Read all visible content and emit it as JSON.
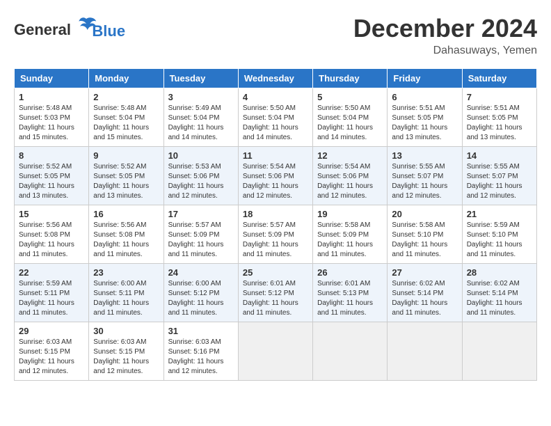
{
  "header": {
    "logo_line1": "General",
    "logo_line2": "Blue",
    "month": "December 2024",
    "location": "Dahasuways, Yemen"
  },
  "weekdays": [
    "Sunday",
    "Monday",
    "Tuesday",
    "Wednesday",
    "Thursday",
    "Friday",
    "Saturday"
  ],
  "weeks": [
    [
      {
        "day": "1",
        "sunrise": "5:48 AM",
        "sunset": "5:03 PM",
        "daylight": "11 hours and 15 minutes."
      },
      {
        "day": "2",
        "sunrise": "5:48 AM",
        "sunset": "5:04 PM",
        "daylight": "11 hours and 15 minutes."
      },
      {
        "day": "3",
        "sunrise": "5:49 AM",
        "sunset": "5:04 PM",
        "daylight": "11 hours and 14 minutes."
      },
      {
        "day": "4",
        "sunrise": "5:50 AM",
        "sunset": "5:04 PM",
        "daylight": "11 hours and 14 minutes."
      },
      {
        "day": "5",
        "sunrise": "5:50 AM",
        "sunset": "5:04 PM",
        "daylight": "11 hours and 14 minutes."
      },
      {
        "day": "6",
        "sunrise": "5:51 AM",
        "sunset": "5:05 PM",
        "daylight": "11 hours and 13 minutes."
      },
      {
        "day": "7",
        "sunrise": "5:51 AM",
        "sunset": "5:05 PM",
        "daylight": "11 hours and 13 minutes."
      }
    ],
    [
      {
        "day": "8",
        "sunrise": "5:52 AM",
        "sunset": "5:05 PM",
        "daylight": "11 hours and 13 minutes."
      },
      {
        "day": "9",
        "sunrise": "5:52 AM",
        "sunset": "5:05 PM",
        "daylight": "11 hours and 13 minutes."
      },
      {
        "day": "10",
        "sunrise": "5:53 AM",
        "sunset": "5:06 PM",
        "daylight": "11 hours and 12 minutes."
      },
      {
        "day": "11",
        "sunrise": "5:54 AM",
        "sunset": "5:06 PM",
        "daylight": "11 hours and 12 minutes."
      },
      {
        "day": "12",
        "sunrise": "5:54 AM",
        "sunset": "5:06 PM",
        "daylight": "11 hours and 12 minutes."
      },
      {
        "day": "13",
        "sunrise": "5:55 AM",
        "sunset": "5:07 PM",
        "daylight": "11 hours and 12 minutes."
      },
      {
        "day": "14",
        "sunrise": "5:55 AM",
        "sunset": "5:07 PM",
        "daylight": "11 hours and 12 minutes."
      }
    ],
    [
      {
        "day": "15",
        "sunrise": "5:56 AM",
        "sunset": "5:08 PM",
        "daylight": "11 hours and 11 minutes."
      },
      {
        "day": "16",
        "sunrise": "5:56 AM",
        "sunset": "5:08 PM",
        "daylight": "11 hours and 11 minutes."
      },
      {
        "day": "17",
        "sunrise": "5:57 AM",
        "sunset": "5:09 PM",
        "daylight": "11 hours and 11 minutes."
      },
      {
        "day": "18",
        "sunrise": "5:57 AM",
        "sunset": "5:09 PM",
        "daylight": "11 hours and 11 minutes."
      },
      {
        "day": "19",
        "sunrise": "5:58 AM",
        "sunset": "5:09 PM",
        "daylight": "11 hours and 11 minutes."
      },
      {
        "day": "20",
        "sunrise": "5:58 AM",
        "sunset": "5:10 PM",
        "daylight": "11 hours and 11 minutes."
      },
      {
        "day": "21",
        "sunrise": "5:59 AM",
        "sunset": "5:10 PM",
        "daylight": "11 hours and 11 minutes."
      }
    ],
    [
      {
        "day": "22",
        "sunrise": "5:59 AM",
        "sunset": "5:11 PM",
        "daylight": "11 hours and 11 minutes."
      },
      {
        "day": "23",
        "sunrise": "6:00 AM",
        "sunset": "5:11 PM",
        "daylight": "11 hours and 11 minutes."
      },
      {
        "day": "24",
        "sunrise": "6:00 AM",
        "sunset": "5:12 PM",
        "daylight": "11 hours and 11 minutes."
      },
      {
        "day": "25",
        "sunrise": "6:01 AM",
        "sunset": "5:12 PM",
        "daylight": "11 hours and 11 minutes."
      },
      {
        "day": "26",
        "sunrise": "6:01 AM",
        "sunset": "5:13 PM",
        "daylight": "11 hours and 11 minutes."
      },
      {
        "day": "27",
        "sunrise": "6:02 AM",
        "sunset": "5:14 PM",
        "daylight": "11 hours and 11 minutes."
      },
      {
        "day": "28",
        "sunrise": "6:02 AM",
        "sunset": "5:14 PM",
        "daylight": "11 hours and 11 minutes."
      }
    ],
    [
      {
        "day": "29",
        "sunrise": "6:03 AM",
        "sunset": "5:15 PM",
        "daylight": "11 hours and 12 minutes."
      },
      {
        "day": "30",
        "sunrise": "6:03 AM",
        "sunset": "5:15 PM",
        "daylight": "11 hours and 12 minutes."
      },
      {
        "day": "31",
        "sunrise": "6:03 AM",
        "sunset": "5:16 PM",
        "daylight": "11 hours and 12 minutes."
      },
      null,
      null,
      null,
      null
    ]
  ]
}
